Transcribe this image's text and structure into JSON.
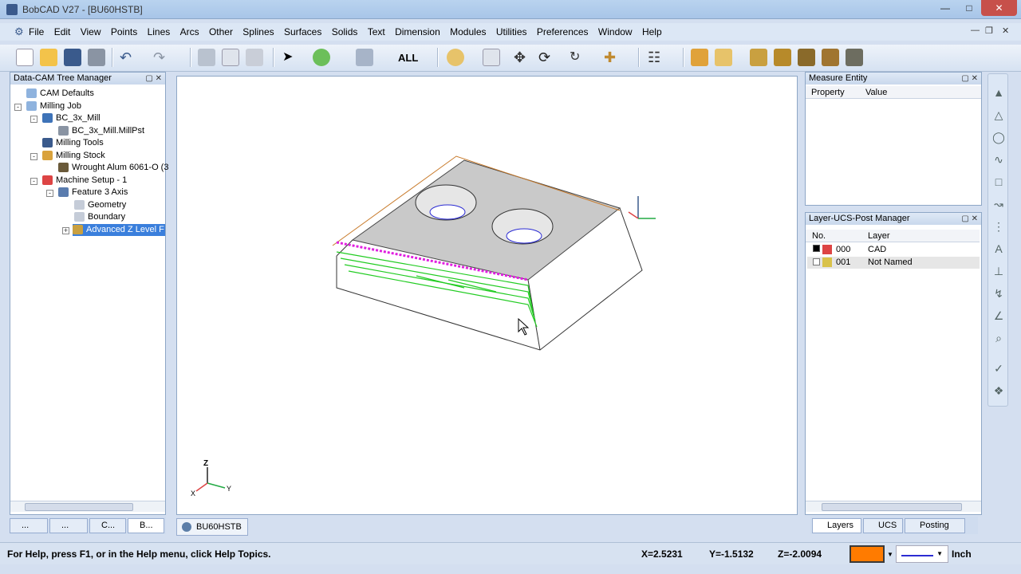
{
  "window": {
    "title": "BobCAD V27 - [BU60HSTB]"
  },
  "menu": [
    "File",
    "Edit",
    "View",
    "Points",
    "Lines",
    "Arcs",
    "Other",
    "Splines",
    "Surfaces",
    "Solids",
    "Text",
    "Dimension",
    "Modules",
    "Utilities",
    "Preferences",
    "Window",
    "Help"
  ],
  "toolbar": {
    "filter_label": "ALL"
  },
  "tree": {
    "title": "Data-CAM Tree Manager",
    "items": [
      {
        "label": "CAM Defaults"
      },
      {
        "label": "Milling Job"
      },
      {
        "label": "BC_3x_Mill"
      },
      {
        "label": "BC_3x_Mill.MillPst"
      },
      {
        "label": "Milling Tools"
      },
      {
        "label": "Milling Stock"
      },
      {
        "label": "Wrought Alum 6061-O (3"
      },
      {
        "label": "Machine Setup - 1"
      },
      {
        "label": "Feature 3 Axis"
      },
      {
        "label": "Geometry"
      },
      {
        "label": "Boundary"
      },
      {
        "label": "Advanced Z Level F"
      }
    ],
    "tabs": [
      "...",
      "...",
      "C...",
      "B..."
    ]
  },
  "viewport": {
    "doc_tab": "BU60HSTB",
    "axis": {
      "x": "X",
      "y": "Y",
      "z": "Z"
    }
  },
  "measure": {
    "title": "Measure Entity",
    "columns": [
      "Property",
      "Value"
    ]
  },
  "layers": {
    "title": "Layer-UCS-Post Manager",
    "columns": [
      "No.",
      "Layer"
    ],
    "rows": [
      {
        "no": "000",
        "name": "CAD"
      },
      {
        "no": "001",
        "name": "Not Named"
      }
    ],
    "tabs": [
      "Layers",
      "UCS",
      "Posting"
    ]
  },
  "status": {
    "help": "For Help, press F1, or in the Help menu, click Help Topics.",
    "x": "X=2.5231",
    "y": "Y=-1.5132",
    "z": "Z=-2.0094",
    "unit": "Inch",
    "color": "#ff7b00"
  }
}
